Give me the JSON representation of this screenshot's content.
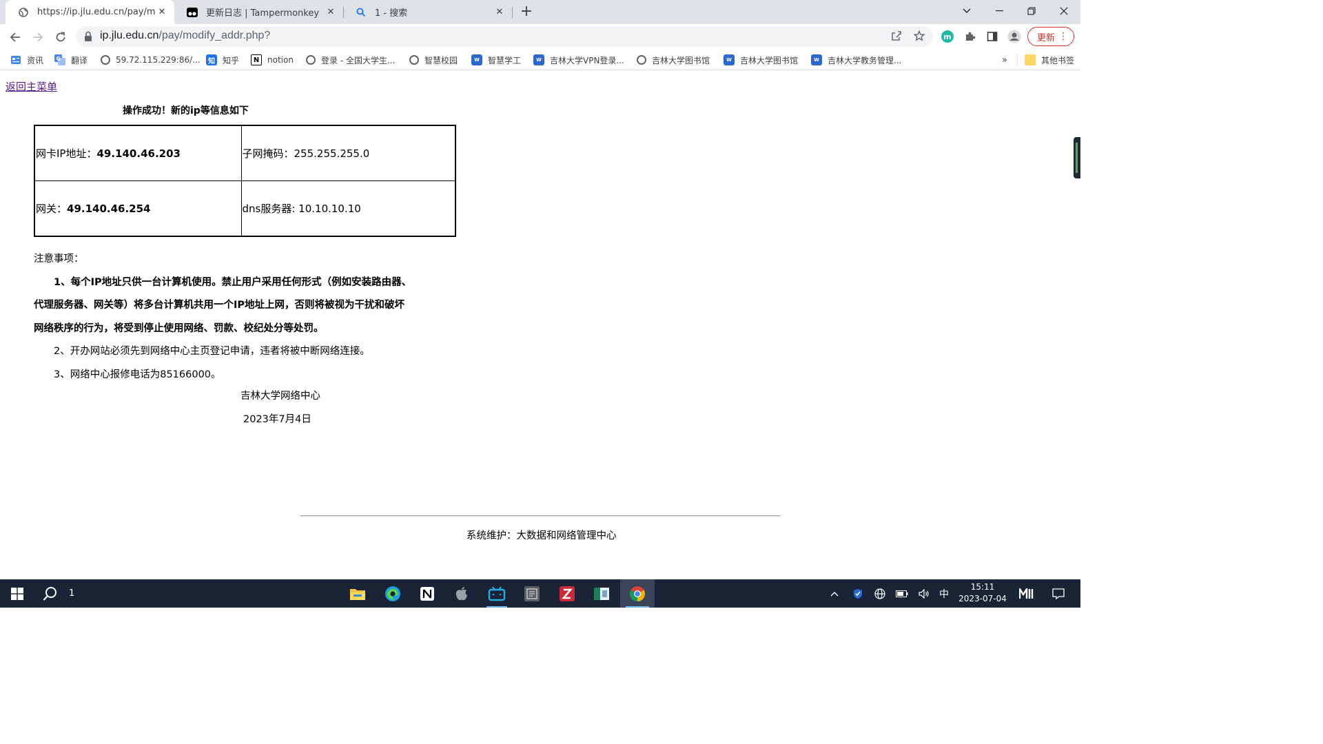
{
  "browser": {
    "tabs": [
      {
        "title": "https://ip.jlu.edu.cn/pay/modi",
        "icon": "globe-icon",
        "active": true
      },
      {
        "title": "更新日志 | Tampermonkey",
        "icon": "tampermonkey-icon",
        "active": false
      },
      {
        "title": "1 - 搜索",
        "icon": "search-icon",
        "active": false
      }
    ],
    "address": {
      "host": "ip.jlu.edu.cn",
      "path": "/pay/modify_addr.php?"
    },
    "update_label": "更新",
    "bookmarks": [
      {
        "label": "资讯",
        "icon": "news-icon"
      },
      {
        "label": "翻译",
        "icon": "translate-icon"
      },
      {
        "label": "59.72.115.229:86/...",
        "icon": "globe-icon"
      },
      {
        "label": "知乎",
        "icon": "zhihu-icon",
        "glyph": "知"
      },
      {
        "label": "notion",
        "icon": "notion-icon",
        "glyph": "N"
      },
      {
        "label": "登录 - 全国大学生...",
        "icon": "globe-icon"
      },
      {
        "label": "智慧校园",
        "icon": "globe-icon"
      },
      {
        "label": "智慧学工",
        "icon": "word-icon"
      },
      {
        "label": "吉林大学VPN登录...",
        "icon": "word-icon"
      },
      {
        "label": "吉林大学图书馆",
        "icon": "globe-icon"
      },
      {
        "label": "吉林大学图书馆",
        "icon": "word-icon"
      },
      {
        "label": "吉林大学教务管理...",
        "icon": "word-icon"
      }
    ],
    "more_bookmarks": "»",
    "other_bookmarks": "其他书签"
  },
  "page": {
    "back_link": "返回主菜单",
    "success_title": "操作成功！新的ip等信息如下",
    "table": {
      "ip_label": "网卡IP地址：",
      "ip_value": "49.140.46.203",
      "mask_label": "子网掩码：",
      "mask_value": "255.255.255.0",
      "gateway_label": "网关：",
      "gateway_value": "49.140.46.254",
      "dns_label": "dns服务器: ",
      "dns_value": "10.10.10.10"
    },
    "notice_head": "注意事项：",
    "notice_1_line1": "1、每个IP地址只供一台计算机使用。禁止用户采用任何形式（例如安装路由器、",
    "notice_1_line2": "代理服务器、网关等）将多台计算机共用一个IP地址上网，否则将被视为干扰和破坏",
    "notice_1_line3": "网络秩序的行为，将受到停止使用网络、罚款、校纪处分等处罚。",
    "notice_2": "2、开办网站必须先到网络中心主页登记申请，违者将被中断网络连接。",
    "notice_3": "3、网络中心报修电话为85166000。",
    "signature": "吉林大学网络中心",
    "date": "2023年7月4日",
    "footer": "系统维护：大数据和网络管理中心"
  },
  "taskbar": {
    "search_count": "1",
    "ime": "中",
    "time": "15:11",
    "date": "2023-07-04"
  }
}
